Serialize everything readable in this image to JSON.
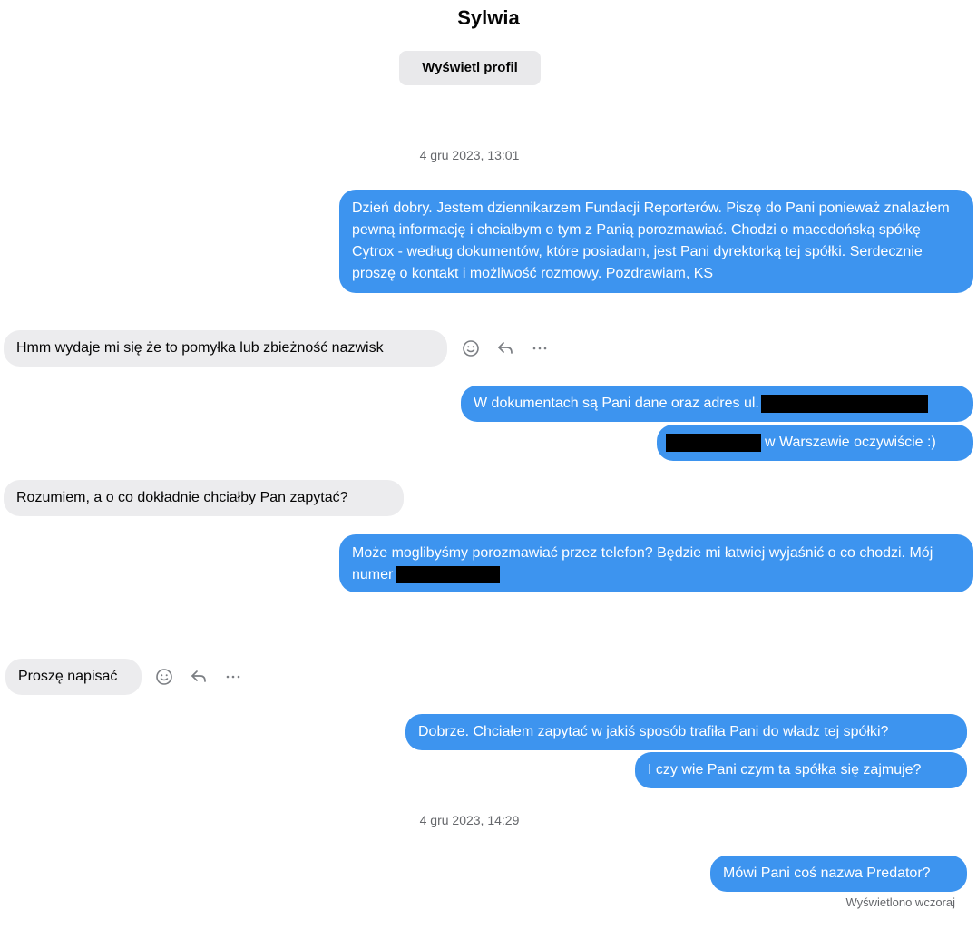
{
  "header": {
    "contact_name": "Sylwia",
    "view_profile_label": "Wyświetl profil"
  },
  "timestamps": {
    "first": "4 gru 2023, 13:01",
    "second": "4 gru 2023, 14:29"
  },
  "messages": {
    "m1": "Dzień dobry. Jestem dziennikarzem Fundacji Reporterów. Piszę do Pani ponieważ znalazłem pewną informację i chciałbym o tym z Panią porozmawiać. Chodzi o macedońską spółkę Cytrox - według dokumentów, które posiadam, jest Pani dyrektorką tej spółki. Serdecznie proszę o kontakt i możliwość rozmowy. Pozdrawiam, KS",
    "m2": "Hmm wydaje mi się że to pomyłka lub zbieżność nazwisk",
    "m3": "W dokumentach są Pani dane oraz adres ul.",
    "m4": "w Warszawie oczywiście :)",
    "m5": "Rozumiem, a o co dokładnie chciałby Pan zapytać?",
    "m6": "Może moglibyśmy porozmawiać przez telefon? Będzie mi łatwiej wyjaśnić o co chodzi. Mój numer",
    "m7": "Proszę napisać",
    "m8": "Dobrze. Chciałem zapytać w jakiś sposób trafiła Pani do władz tej spółki?",
    "m9": "I czy wie Pani czym ta spółka się zajmuje?",
    "m10": "Mówi Pani coś nazwa Predator?"
  },
  "status": {
    "seen_label": "Wyświetlono wczoraj"
  },
  "icons": {
    "react": "smiley-icon",
    "reply": "reply-arrow-icon",
    "more": "more-dots-icon"
  },
  "colors": {
    "outgoing_bubble": "#3d94ef",
    "incoming_bubble": "#ececee",
    "redaction": "#000000",
    "muted_text": "#65676b"
  }
}
